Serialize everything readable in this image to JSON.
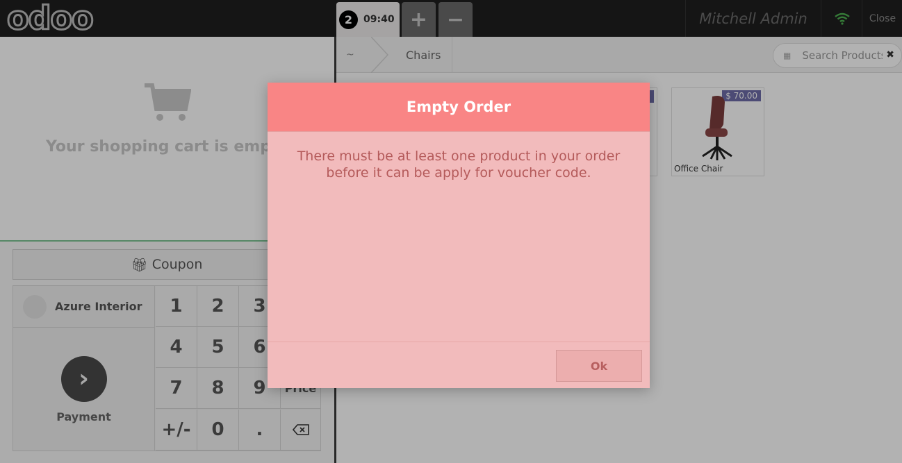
{
  "header": {
    "logo": "odoo",
    "order_number": "2",
    "order_time": "09:40",
    "add_tab": "+",
    "remove_tab": "−",
    "cashier": "Mitchell Admin",
    "close": "Close"
  },
  "cart": {
    "empty_text": "Your shopping cart is emp"
  },
  "actions": {
    "coupon": "Coupon"
  },
  "pad": {
    "customer": "Azure Interior",
    "payment": "Payment",
    "keys": [
      "1",
      "2",
      "3",
      "4",
      "5",
      "6",
      "7",
      "8",
      "9",
      "+/-",
      "0",
      "."
    ],
    "price_label": "Price"
  },
  "products_screen": {
    "breadcrumb_home": "~",
    "breadcrumb_category": "Chairs",
    "search_placeholder": "Search Products",
    "products": [
      {
        "name": "Office Chair",
        "price": "$ 70.00"
      }
    ]
  },
  "dialog": {
    "title": "Empty Order",
    "body": "There must be at least one product in your order before it can be apply for voucher code.",
    "ok": "Ok"
  },
  "colors": {
    "dialog_header": "#f98585",
    "dialog_body": "#f2bbbc",
    "price_badge": "#6e6ca8",
    "wifi": "#4caf50"
  }
}
